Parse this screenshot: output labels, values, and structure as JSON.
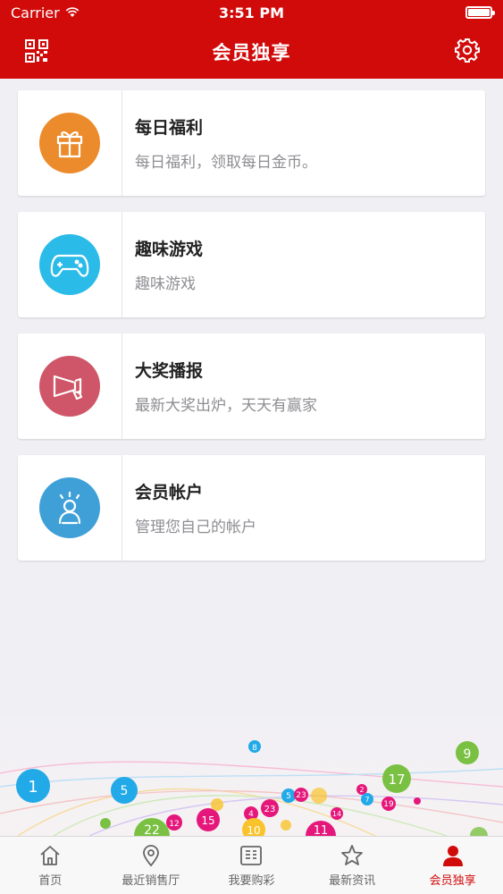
{
  "status_bar": {
    "carrier": "Carrier",
    "time": "3:51 PM"
  },
  "nav": {
    "title": "会员独享",
    "left_icon": "qr-code-icon",
    "right_icon": "gear-icon"
  },
  "cards": [
    {
      "title": "每日福利",
      "subtitle": "每日福利，领取每日金币。",
      "icon": "gift-icon",
      "color": "#ec8b2c"
    },
    {
      "title": "趣味游戏",
      "subtitle": "趣味游戏",
      "icon": "gamepad-icon",
      "color": "#2bbbe8"
    },
    {
      "title": "大奖播报",
      "subtitle": "最新大奖出炉，天天有赢家",
      "icon": "megaphone-icon",
      "color": "#cf5668"
    },
    {
      "title": "会员帐户",
      "subtitle": "管理您自己的帐户",
      "icon": "user-icon",
      "color": "#3fa0d8"
    }
  ],
  "decoration": {
    "balls": [
      "8",
      "9",
      "1",
      "5",
      "17",
      "5",
      "23",
      "2",
      "7",
      "19",
      "15",
      "23",
      "4",
      "12",
      "14",
      "10",
      "22",
      "11"
    ]
  },
  "tabbar": {
    "items": [
      {
        "label": "首页",
        "icon": "home-icon"
      },
      {
        "label": "最近销售厅",
        "icon": "location-pin-icon"
      },
      {
        "label": "我要购彩",
        "icon": "ticket-icon"
      },
      {
        "label": "最新资讯",
        "icon": "star-icon"
      },
      {
        "label": "会员独享",
        "icon": "person-icon"
      }
    ],
    "active_index": 4
  },
  "colors": {
    "brand_red": "#d10a0a",
    "background": "#efeff4"
  }
}
